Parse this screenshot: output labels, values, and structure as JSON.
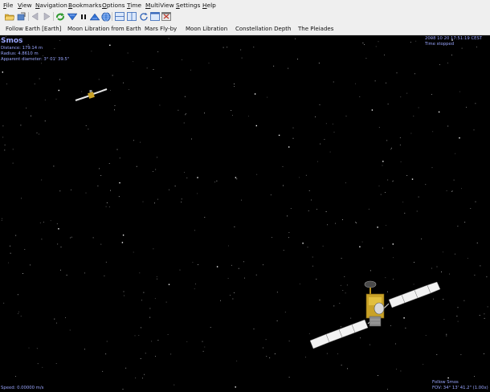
{
  "menu": [
    {
      "key": "file",
      "underline": "F",
      "rest": "ile"
    },
    {
      "key": "view",
      "underline": "V",
      "rest": "iew"
    },
    {
      "key": "navigation",
      "underline": "N",
      "rest": "avigation"
    },
    {
      "key": "bookmarks",
      "underline": "B",
      "rest": "ookmarks"
    },
    {
      "key": "options",
      "underline": "O",
      "rest": "ptions"
    },
    {
      "key": "time",
      "underline": "T",
      "rest": "ime"
    },
    {
      "key": "multiview",
      "underline": "M",
      "rest": "ultiView"
    },
    {
      "key": "settings",
      "underline": "S",
      "rest": "ettings"
    },
    {
      "key": "help",
      "underline": "H",
      "rest": "elp"
    }
  ],
  "toolbar_icons": [
    "open-folder-icon",
    "capture-icon",
    "back-arrow-icon",
    "forward-arrow-icon",
    "reverse-time-icon",
    "slower-icon",
    "pause-icon",
    "faster-icon",
    "globe-icon",
    "split-horizontal-icon",
    "split-vertical-icon",
    "cycle-view-icon",
    "single-view-icon",
    "exit-icon"
  ],
  "bookmarks": [
    "Follow Earth [Earth]",
    "Moon Libration from Earth",
    "Mars Fly-by",
    "Moon Libration",
    "Constellation Depth",
    "The Pleiades"
  ],
  "hud": {
    "object_name": "Smos",
    "distance": "Distance: 179.14 m",
    "radius": "Radius: 4.8610 m",
    "apparent_diameter": "Apparent diameter: 3° 01' 39.5\"",
    "datetime": "2008 10 20 17:51:19 CEST",
    "time_status": "Time stopped",
    "speed": "Speed: 0.00000 m/s",
    "follow": "Follow Smos",
    "fov": "FOV: 34° 13' 41.2\" (1.00x)"
  },
  "colors": {
    "hud_text": "#9aa6ff",
    "space": "#000000",
    "solar_panel": "#f2f2f2",
    "satellite_body": "#c9a227"
  }
}
